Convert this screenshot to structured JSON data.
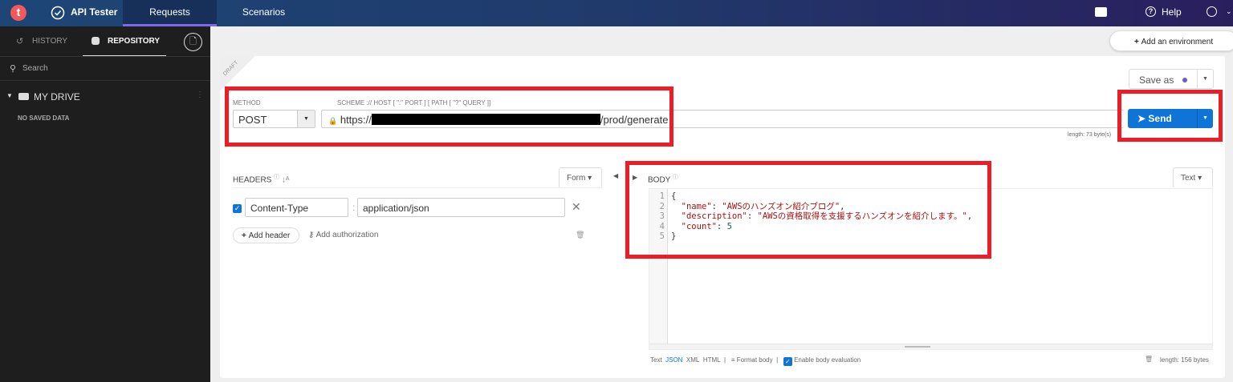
{
  "topbar": {
    "logo": "t",
    "app_name": "API Tester",
    "tabs": [
      {
        "label": "Requests",
        "active": true
      },
      {
        "label": "Scenarios",
        "active": false
      }
    ],
    "help": "Help",
    "icons": [
      "chat-icon",
      "help-icon",
      "user-icon"
    ]
  },
  "sidebar": {
    "tabs": [
      "HISTORY",
      "REPOSITORY"
    ],
    "active_tab": "REPOSITORY",
    "search_placeholder": "Search",
    "drive": "MY DRIVE",
    "empty": "NO SAVED DATA"
  },
  "env_button": "Add an environment",
  "request": {
    "draft": "DRAFT",
    "method_label": "METHOD",
    "method": "POST",
    "url_label": "SCHEME :// HOST [ \":\" PORT ] [ PATH [ \"?\" QUERY ]]",
    "url_prefix": "https://",
    "url_suffix": "/prod/generate",
    "length": "length: 73 byte(s)",
    "save_as": "Save as",
    "send": "Send"
  },
  "headers": {
    "title": "HEADERS",
    "mode": "Form",
    "rows": [
      {
        "checked": true,
        "name": "Content-Type",
        "value": "application/json"
      }
    ],
    "add_header": "Add header",
    "add_authorization": "Add authorization"
  },
  "body": {
    "title": "BODY",
    "mode": "Text",
    "lines": [
      [
        {
          "t": "{",
          "c": "p"
        }
      ],
      [
        {
          "t": "  ",
          "c": "p"
        },
        {
          "t": "\"name\"",
          "c": "key"
        },
        {
          "t": ": ",
          "c": "p"
        },
        {
          "t": "\"AWSのハンズオン紹介ブログ\"",
          "c": "str"
        },
        {
          "t": ",",
          "c": "p"
        }
      ],
      [
        {
          "t": "  ",
          "c": "p"
        },
        {
          "t": "\"description\"",
          "c": "key"
        },
        {
          "t": ": ",
          "c": "p"
        },
        {
          "t": "\"AWSの資格取得を支援するハンズオンを紹介します。\"",
          "c": "str"
        },
        {
          "t": ",",
          "c": "p"
        }
      ],
      [
        {
          "t": "  ",
          "c": "p"
        },
        {
          "t": "\"count\"",
          "c": "key"
        },
        {
          "t": ": ",
          "c": "p"
        },
        {
          "t": "5",
          "c": "num"
        }
      ],
      [
        {
          "t": "}",
          "c": "p"
        }
      ]
    ],
    "formats": [
      "Text",
      "JSON",
      "XML",
      "HTML"
    ],
    "active_format": "JSON",
    "format_body": "Format body",
    "enable_eval": "Enable body evaluation",
    "enable_eval_checked": true,
    "length": "length: 156 bytes"
  },
  "colors": {
    "accent": "#0f74d8",
    "highlight": "#ee1c25",
    "active_tab_underline": "#7b68ee"
  }
}
